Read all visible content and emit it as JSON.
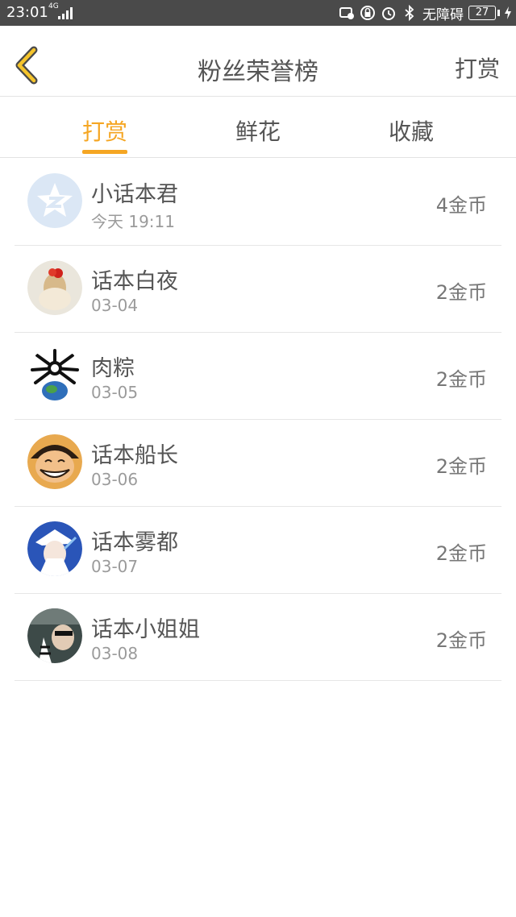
{
  "status_bar": {
    "time": "23:01",
    "network": "4G",
    "accessibility": "无障碍",
    "battery": "27"
  },
  "header": {
    "title": "粉丝荣誉榜",
    "action_label": "打赏",
    "back_icon": "chevron-left-icon"
  },
  "tabs": [
    {
      "label": "打赏",
      "active": true
    },
    {
      "label": "鲜花",
      "active": false
    },
    {
      "label": "收藏",
      "active": false
    }
  ],
  "colors": {
    "accent": "#f5a623",
    "status_bar": "#4a4a4a",
    "text": "#555555",
    "subtext": "#9b9b9b"
  },
  "fans": [
    {
      "name": "小话本君",
      "date": "今天 19:11",
      "amount": "4金币"
    },
    {
      "name": "话本白夜",
      "date": "03-04",
      "amount": "2金币"
    },
    {
      "name": "肉粽",
      "date": "03-05",
      "amount": "2金币"
    },
    {
      "name": "话本船长",
      "date": "03-06",
      "amount": "2金币"
    },
    {
      "name": "话本雾都",
      "date": "03-07",
      "amount": "2金币"
    },
    {
      "name": "话本小姐姐",
      "date": "03-08",
      "amount": "2金币"
    }
  ]
}
